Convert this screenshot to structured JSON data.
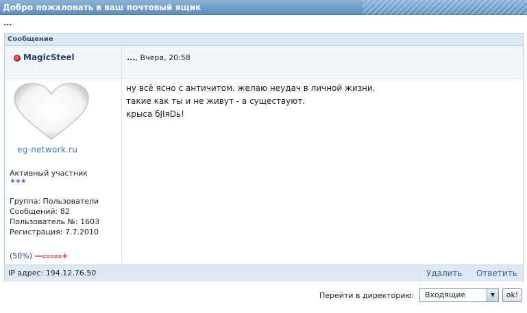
{
  "title_bar": {
    "title": "Добро пожаловать в ваш почтовый ящик"
  },
  "breadcrumb": "...",
  "post": {
    "header_label": "Сообщение",
    "author": {
      "name": "MagicSteel"
    },
    "date_prefix": "...",
    "date": ", Вчера, 20:58",
    "avatar_caption": "eg-network.ru",
    "rank": "Активный участник",
    "stars": "★★★",
    "info": [
      "Группа: Пользователи",
      "Сообщений: 82",
      "Пользователь №: 1603",
      "Регистрация: 7.7.2010"
    ],
    "reputation": {
      "value": "(50%)",
      "minus": "—",
      "bars": "¤¤¤¤¤",
      "plus": "+"
    },
    "message_lines": [
      "ну всё ясно с античитом. желаю неудач в личной жизни.",
      "такие как ты и не живут - а существуют.",
      "крыса бJIяDь!"
    ],
    "ip": "IP адрес: 194.12.76.50",
    "delete_label": "Удалить",
    "reply_label": "Ответить"
  },
  "jump": {
    "label": "Перейти в директорию:",
    "selected": "Входящие",
    "ok_label": "ok!"
  },
  "colors": {
    "title_bar": "#5d8fc0",
    "header_bg": "#dfe9f5",
    "link": "#2f5f9a",
    "status_dot": "#b01c10",
    "stars": "#5a6ad8"
  }
}
